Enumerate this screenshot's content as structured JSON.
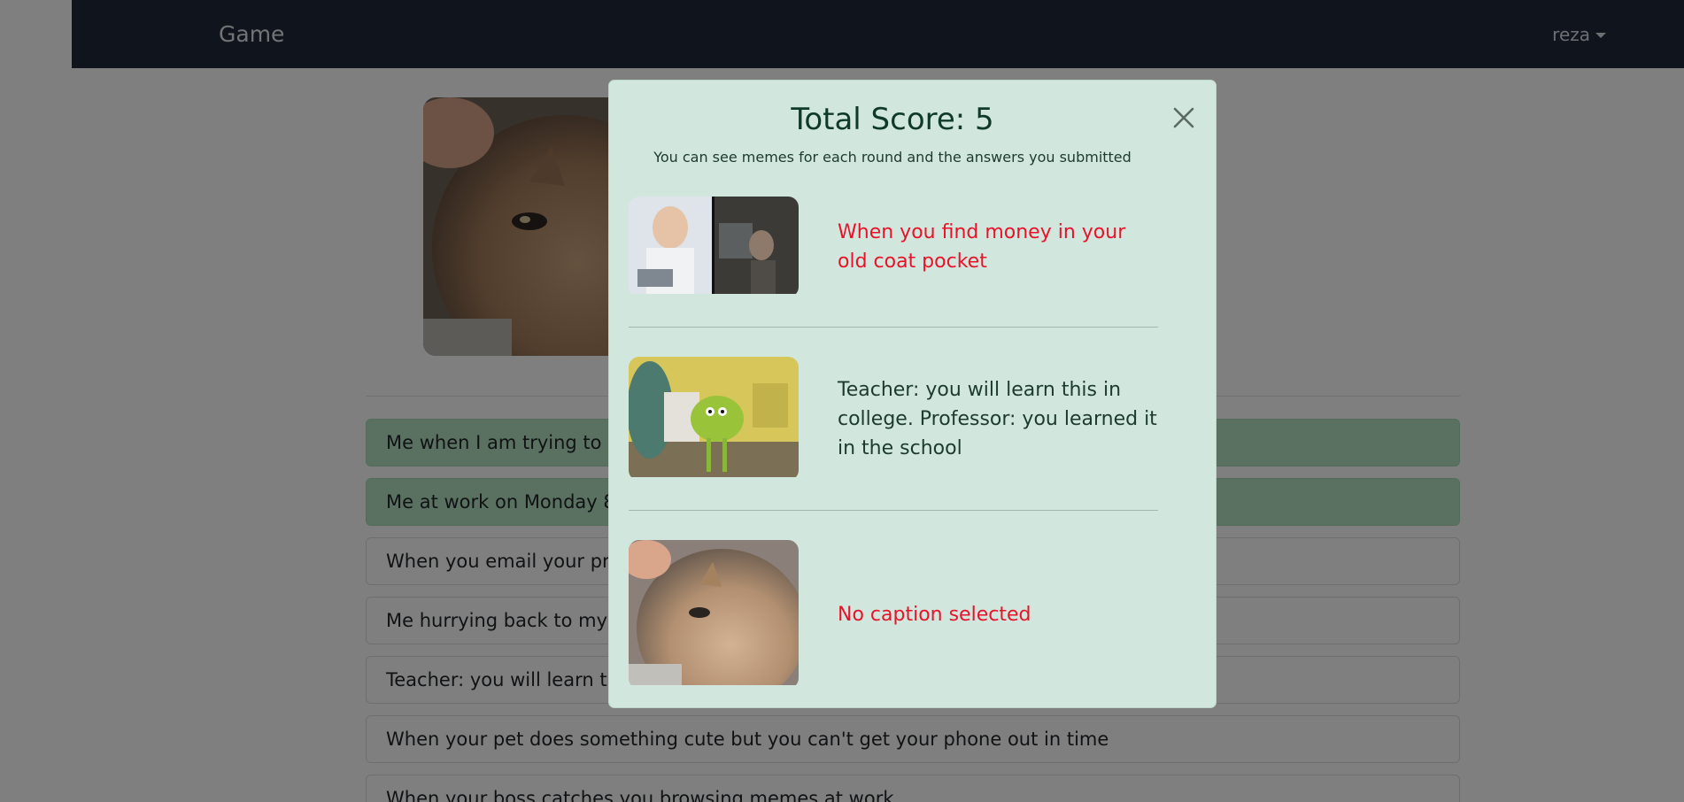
{
  "navbar": {
    "brand": "Game",
    "user": "reza"
  },
  "options": [
    {
      "label": "Me when I am trying to c",
      "selected": true
    },
    {
      "label": "Me at work on Monday 8",
      "selected": true
    },
    {
      "label": "When you email your pro",
      "selected": false
    },
    {
      "label": "Me hurrying back to my d",
      "selected": false
    },
    {
      "label": "Teacher: you will learn thi",
      "selected": false
    },
    {
      "label": "When your pet does something cute but you can't get your phone out in time",
      "selected": false
    },
    {
      "label": "When your boss catches you browsing memes at work",
      "selected": false
    }
  ],
  "modal": {
    "title": "Total Score: 5",
    "subtitle": "You can see memes for each round and the answers you submitted",
    "rounds": [
      {
        "caption": "When you find money in your old coat pocket",
        "status": "wrong",
        "meme": "mr-incredible-meme"
      },
      {
        "caption": "Teacher: you will learn this in college. Professor: you learned it in the school",
        "status": "correct",
        "meme": "mike-wazowski-meme"
      },
      {
        "caption": "No caption selected",
        "status": "none",
        "meme": "cat-meme"
      }
    ],
    "colors": {
      "wrong": "#e8132a",
      "correct": "#1d3a30",
      "modal_bg": "#d1e7dd",
      "selected_option": "#b5e3c4"
    }
  },
  "icons": {
    "close": "close-icon",
    "caret": "caret-down-icon"
  }
}
